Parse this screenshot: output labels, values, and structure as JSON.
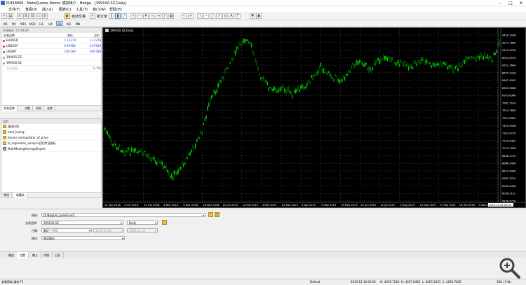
{
  "window": {
    "title": "21858906 - MetaQuotes-Demo: 模拟帐户 - Hedge - [399100.SZ,Daily]",
    "buttons": [
      "–",
      "□",
      "✕"
    ]
  },
  "menu": [
    "文件(F)",
    "查看(V)",
    "插入(I)",
    "图表(C)",
    "工具(T)",
    "窗口(W)",
    "帮助(H)"
  ],
  "toolbar": {
    "autotrade_label": "自动交易",
    "neworder_label": "新订单",
    "icons": [
      "new-chart-icon",
      "profiles-icon",
      "market-watch-icon",
      "data-window-icon",
      "navigator-icon",
      "terminal-icon",
      "tester-icon"
    ]
  },
  "timeframes": [
    "M1",
    "M5",
    "M15",
    "M30",
    "H1",
    "H4",
    "D1",
    "W1",
    "MN"
  ],
  "timeframe_selected": "D1",
  "market_watch": {
    "header": "市场报价: 17:09:29",
    "col_symbol": "交易品种",
    "col_bid": "卖价",
    "col_ask": "买价",
    "rows": [
      {
        "symbol": "EURUSD",
        "bid": "1.11274",
        "ask": "1.11278",
        "color": "#d33"
      },
      {
        "symbol": "USDCHF",
        "bid": "0.97982",
        "ask": "0.97988",
        "color": "#d33"
      },
      {
        "symbol": "USDJPY",
        "bid": "109.584",
        "ask": "109.588",
        "color": "#d33"
      },
      {
        "symbol": "300015.SZ",
        "bid": "",
        "ask": "",
        "color": "#999"
      },
      {
        "symbol": "399100.SZ",
        "bid": "",
        "ask": "",
        "color": "#999"
      }
    ],
    "add_hint": "点击添加...",
    "count": "5 / 66",
    "tabs": [
      "交易品种",
      "详细",
      "交易",
      "走势"
    ]
  },
  "navigator": {
    "header": "导航",
    "items": [
      {
        "label": "波段识别",
        "type": "indicator"
      },
      {
        "label": "emd_huang",
        "type": "indicator"
      },
      {
        "label": "fourier_extrapolator_of_price",
        "type": "indicator"
      },
      {
        "label": "lo_regression_analysis回归专业指标",
        "type": "indicator"
      },
      {
        "label": "MultiMovingAverageExpert",
        "type": "expert"
      }
    ],
    "tabs": [
      "常用",
      "收藏夹"
    ]
  },
  "chart": {
    "title": "399100.SZ,Daily",
    "price_labels": [
      "9439.1036",
      "9277.1680",
      "9115.2296",
      "8953.2970",
      "8791.3644",
      "8629.4318",
      "8467.4992",
      "8305.5666",
      "8143.6340",
      "7981.7014",
      "7819.7688",
      "7657.8362",
      "7495.9036",
      "7333.9710",
      "7172.0384",
      "7010.1058",
      "6848.1732",
      "6686.2406",
      "6524.3080",
      "6362.3754",
      "6200.4428",
      "6038.5102",
      "5876.5776"
    ],
    "date_labels": [
      "12 Sep 2018",
      "2 Oct 2018",
      "22 Oct 2018",
      "8 Nov 2018",
      "6 Dec 2018",
      "28 Dec 2018",
      "21 Jan 2019",
      "12 Feb 2019",
      "4 Mar 2019",
      "22 Mar 2019",
      "9 Apr 2019",
      "9 May 2019",
      "29 May 2019",
      "20 Jun 2019",
      "12 Jul 2019",
      "2 Aug 2019",
      "23 Aug 2019",
      "17 Sep 2019",
      "16 Oct 2019",
      "5 Nov 2019",
      "2019.12.18 00:00"
    ],
    "up_color": "#00cc00",
    "down_color": "#00cc00",
    "grid_color": "#5a5a5a"
  },
  "tester": {
    "expert_label": "指标:",
    "expert_value": "D:/Bags/ol_Jumels.ex5",
    "symbol_label": "交易品种:",
    "symbol_value": "399100.SZ",
    "period_value": "Daily",
    "date_label": "日期:",
    "date_range_value": "最近一个月",
    "date_from": "2019.12.05",
    "date_to": "2019.12.18",
    "mode_label": "模式:",
    "mode_value": "每次报价"
  },
  "bottom_tabs": [
    "概述",
    "设置",
    "输入",
    "代理",
    "日志"
  ],
  "bottom_tab_selected": "设置",
  "status": {
    "help": "查看帮助,请按 F1",
    "profile": "Default",
    "quote": "2019.12.18 00:00     O: 4039.7240  H: 4057.6400  L: 4025.3433  C: 4050.7826",
    "traffic": "168 / 9 Kb"
  }
}
